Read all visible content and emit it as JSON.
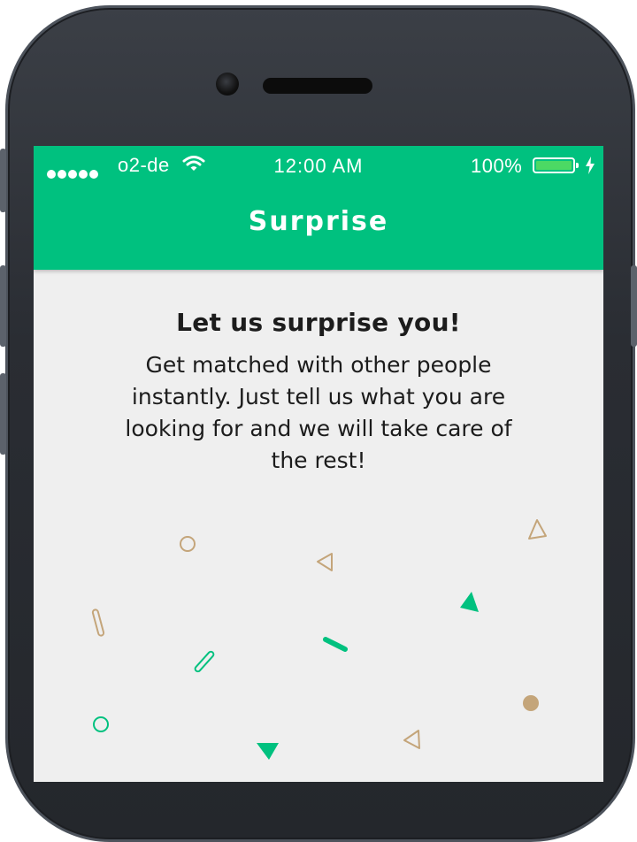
{
  "status_bar": {
    "carrier": "o2-de",
    "time": "12:00 AM",
    "battery_percent": "100%",
    "signal_bars": 5,
    "battery_level": 1.0,
    "charging": true
  },
  "navbar": {
    "title": "Surprise",
    "color": "#00c17f"
  },
  "content": {
    "heading": "Let us surprise you!",
    "description": "Get matched with other people instantly. Just tell us what you are looking for and we will take care of the rest!"
  },
  "colors": {
    "accent": "#00c17f",
    "confetti_tan": "#c4a57a",
    "background": "#efefef"
  },
  "icons": [
    "wifi-icon",
    "battery-icon",
    "charging-bolt-icon"
  ]
}
